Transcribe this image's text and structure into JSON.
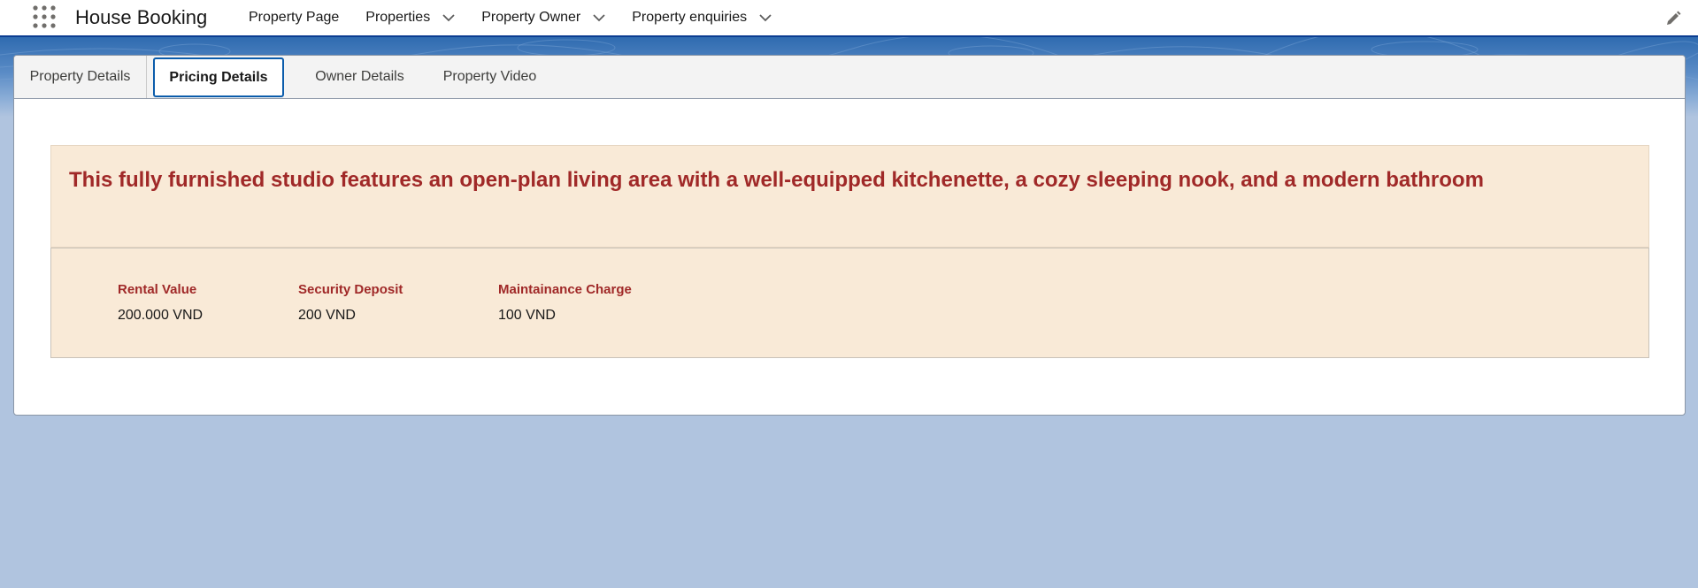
{
  "app": {
    "name": "House Booking"
  },
  "nav": {
    "items": [
      {
        "label": "Property Page",
        "has_dropdown": false
      },
      {
        "label": "Properties",
        "has_dropdown": true
      },
      {
        "label": "Property Owner",
        "has_dropdown": true
      },
      {
        "label": "Property enquiries",
        "has_dropdown": true
      }
    ]
  },
  "icons": {
    "launcher": "app-launcher-grid-icon",
    "edit": "pencil-edit-icon",
    "chevron": "chevron-down-icon"
  },
  "tabs": [
    {
      "label": "Property Details",
      "active": false
    },
    {
      "label": "Pricing Details",
      "active": true
    },
    {
      "label": "Owner Details",
      "active": false
    },
    {
      "label": "Property Video",
      "active": false
    }
  ],
  "description": "This fully furnished studio features an open-plan living area with a well-equipped kitchenette, a cozy sleeping nook, and a modern bathroom",
  "pricing": {
    "rental_value": {
      "label": "Rental Value",
      "value": "200.000 VND"
    },
    "security_deposit": {
      "label": "Security Deposit",
      "value": "200 VND"
    },
    "maintenance_charge": {
      "label": "Maintainance Charge",
      "value": "100 VND"
    }
  },
  "colors": {
    "accent_text": "#a02928",
    "panel_bg": "#f9ead7",
    "active_tab_border": "#0b5cab",
    "header_border": "#0b3d91",
    "page_bg": "#b0c4df"
  }
}
